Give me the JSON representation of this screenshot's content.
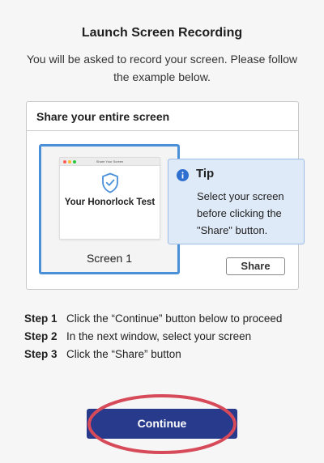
{
  "header": {
    "title": "Launch Screen Recording",
    "subtitle": "You will be asked to record your screen. Please follow the example below."
  },
  "example_panel": {
    "heading": "Share your entire screen",
    "screen_card": {
      "window_title": "Share Your Screen",
      "window_heading": "Your Honorlock Test",
      "label": "Screen 1",
      "icon": "shield-check-icon"
    },
    "share_button_label": "Share",
    "tip": {
      "icon": "info-icon",
      "title": "Tip",
      "body": "Select your screen before clicking the \"Share\" button."
    }
  },
  "steps": [
    {
      "number": "Step 1",
      "text": "Click the “Continue” button below to proceed"
    },
    {
      "number": "Step 2",
      "text": "In the next window, select your screen"
    },
    {
      "number": "Step 3",
      "text": "Click the “Share” button"
    }
  ],
  "continue_button": {
    "label": "Continue"
  },
  "colors": {
    "accent": "#4a90d9",
    "primary_button": "#273a8c",
    "tip_background": "#dfeaf8",
    "highlight_ellipse": "#d64a5a"
  }
}
